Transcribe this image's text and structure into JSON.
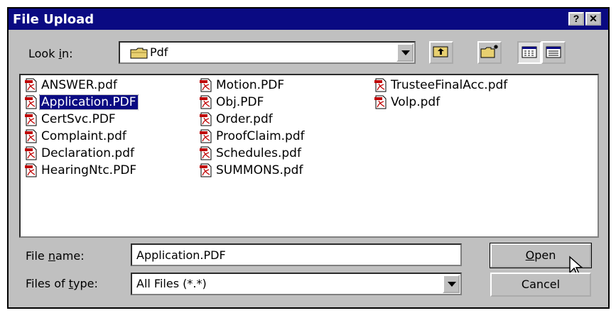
{
  "window": {
    "title": "File Upload",
    "help_label": "?",
    "close_label": "✕"
  },
  "look_in": {
    "label_pre": "Look ",
    "label_u": "i",
    "label_post": "n:",
    "value": "Pdf"
  },
  "toolbar": {
    "up_icon": "up-one-level-icon",
    "new_folder_icon": "new-folder-icon",
    "list_view_icon": "list-view-icon",
    "details_view_icon": "details-view-icon"
  },
  "files": [
    [
      "ANSWER.pdf",
      "Application.PDF",
      "CertSvc.PDF",
      "Complaint.pdf",
      "Declaration.pdf",
      "HearingNtc.PDF"
    ],
    [
      "Motion.PDF",
      "Obj.PDF",
      "Order.pdf",
      "ProofClaim.pdf",
      "Schedules.pdf",
      "SUMMONS.pdf"
    ],
    [
      "TrusteeFinalAcc.pdf",
      "Volp.pdf"
    ]
  ],
  "selected_file": "Application.PDF",
  "file_name": {
    "label_pre": "File ",
    "label_u": "n",
    "label_post": "ame:",
    "value": "Application.PDF"
  },
  "file_type": {
    "label_pre": "Files of ",
    "label_u": "t",
    "label_post": "ype:",
    "value": "All Files (*.*)"
  },
  "buttons": {
    "open_u": "O",
    "open_rest": "pen",
    "cancel": "Cancel"
  },
  "colors": {
    "titlebar": "#0a0a82",
    "face": "#c0c0c0",
    "selection": "#0a0a82"
  }
}
